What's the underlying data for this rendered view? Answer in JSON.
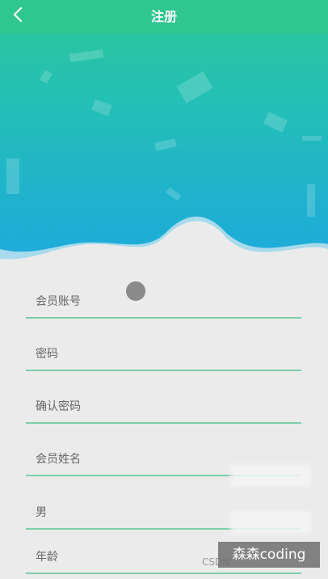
{
  "header": {
    "title": "注册",
    "back_icon": "chevron-left-icon"
  },
  "form": {
    "fields": [
      {
        "name": "member-account-input",
        "placeholder": "会员账号",
        "value": ""
      },
      {
        "name": "password-input",
        "placeholder": "密码",
        "value": ""
      },
      {
        "name": "confirm-password-input",
        "placeholder": "确认密码",
        "value": ""
      },
      {
        "name": "member-name-input",
        "placeholder": "会员姓名",
        "value": ""
      },
      {
        "name": "gender-input",
        "placeholder": "男",
        "value": ""
      },
      {
        "name": "age-input",
        "placeholder": "年龄",
        "value": ""
      }
    ]
  },
  "watermark": {
    "text": "森森coding",
    "source": "CSDN"
  },
  "colors": {
    "header_bg": "#2fc690",
    "hero_top": "#2ec79a",
    "hero_bottom": "#1da9de",
    "field_underline": "#7ccfaa",
    "page_bg": "#ebebeb"
  }
}
